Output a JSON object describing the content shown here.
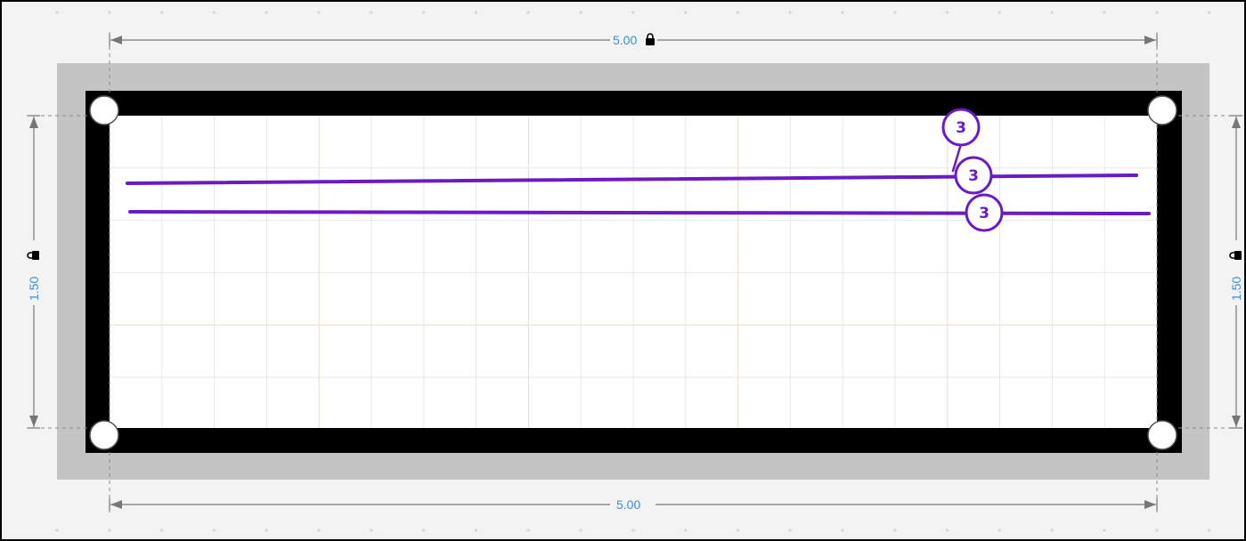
{
  "canvas": {
    "colors": {
      "background": "#f3f3f3",
      "margin_band": "#c4c4c4",
      "frame": "#000000",
      "board": "#ffffff",
      "grid_minor": "#dfe6ee",
      "grid_major": "#f4d9c4",
      "dimension_line": "#777777",
      "dimension_text": "#3b8fd6",
      "annotation": "#6a1bc2"
    }
  },
  "dimensions": {
    "top_width": "5.00",
    "bottom_width": "5.00",
    "left_height": "1.50",
    "right_height": "1.50",
    "lock_icon": "padlock-icon"
  },
  "annotations": {
    "badges": [
      {
        "label": "3"
      },
      {
        "label": "3"
      },
      {
        "label": "3"
      }
    ]
  }
}
